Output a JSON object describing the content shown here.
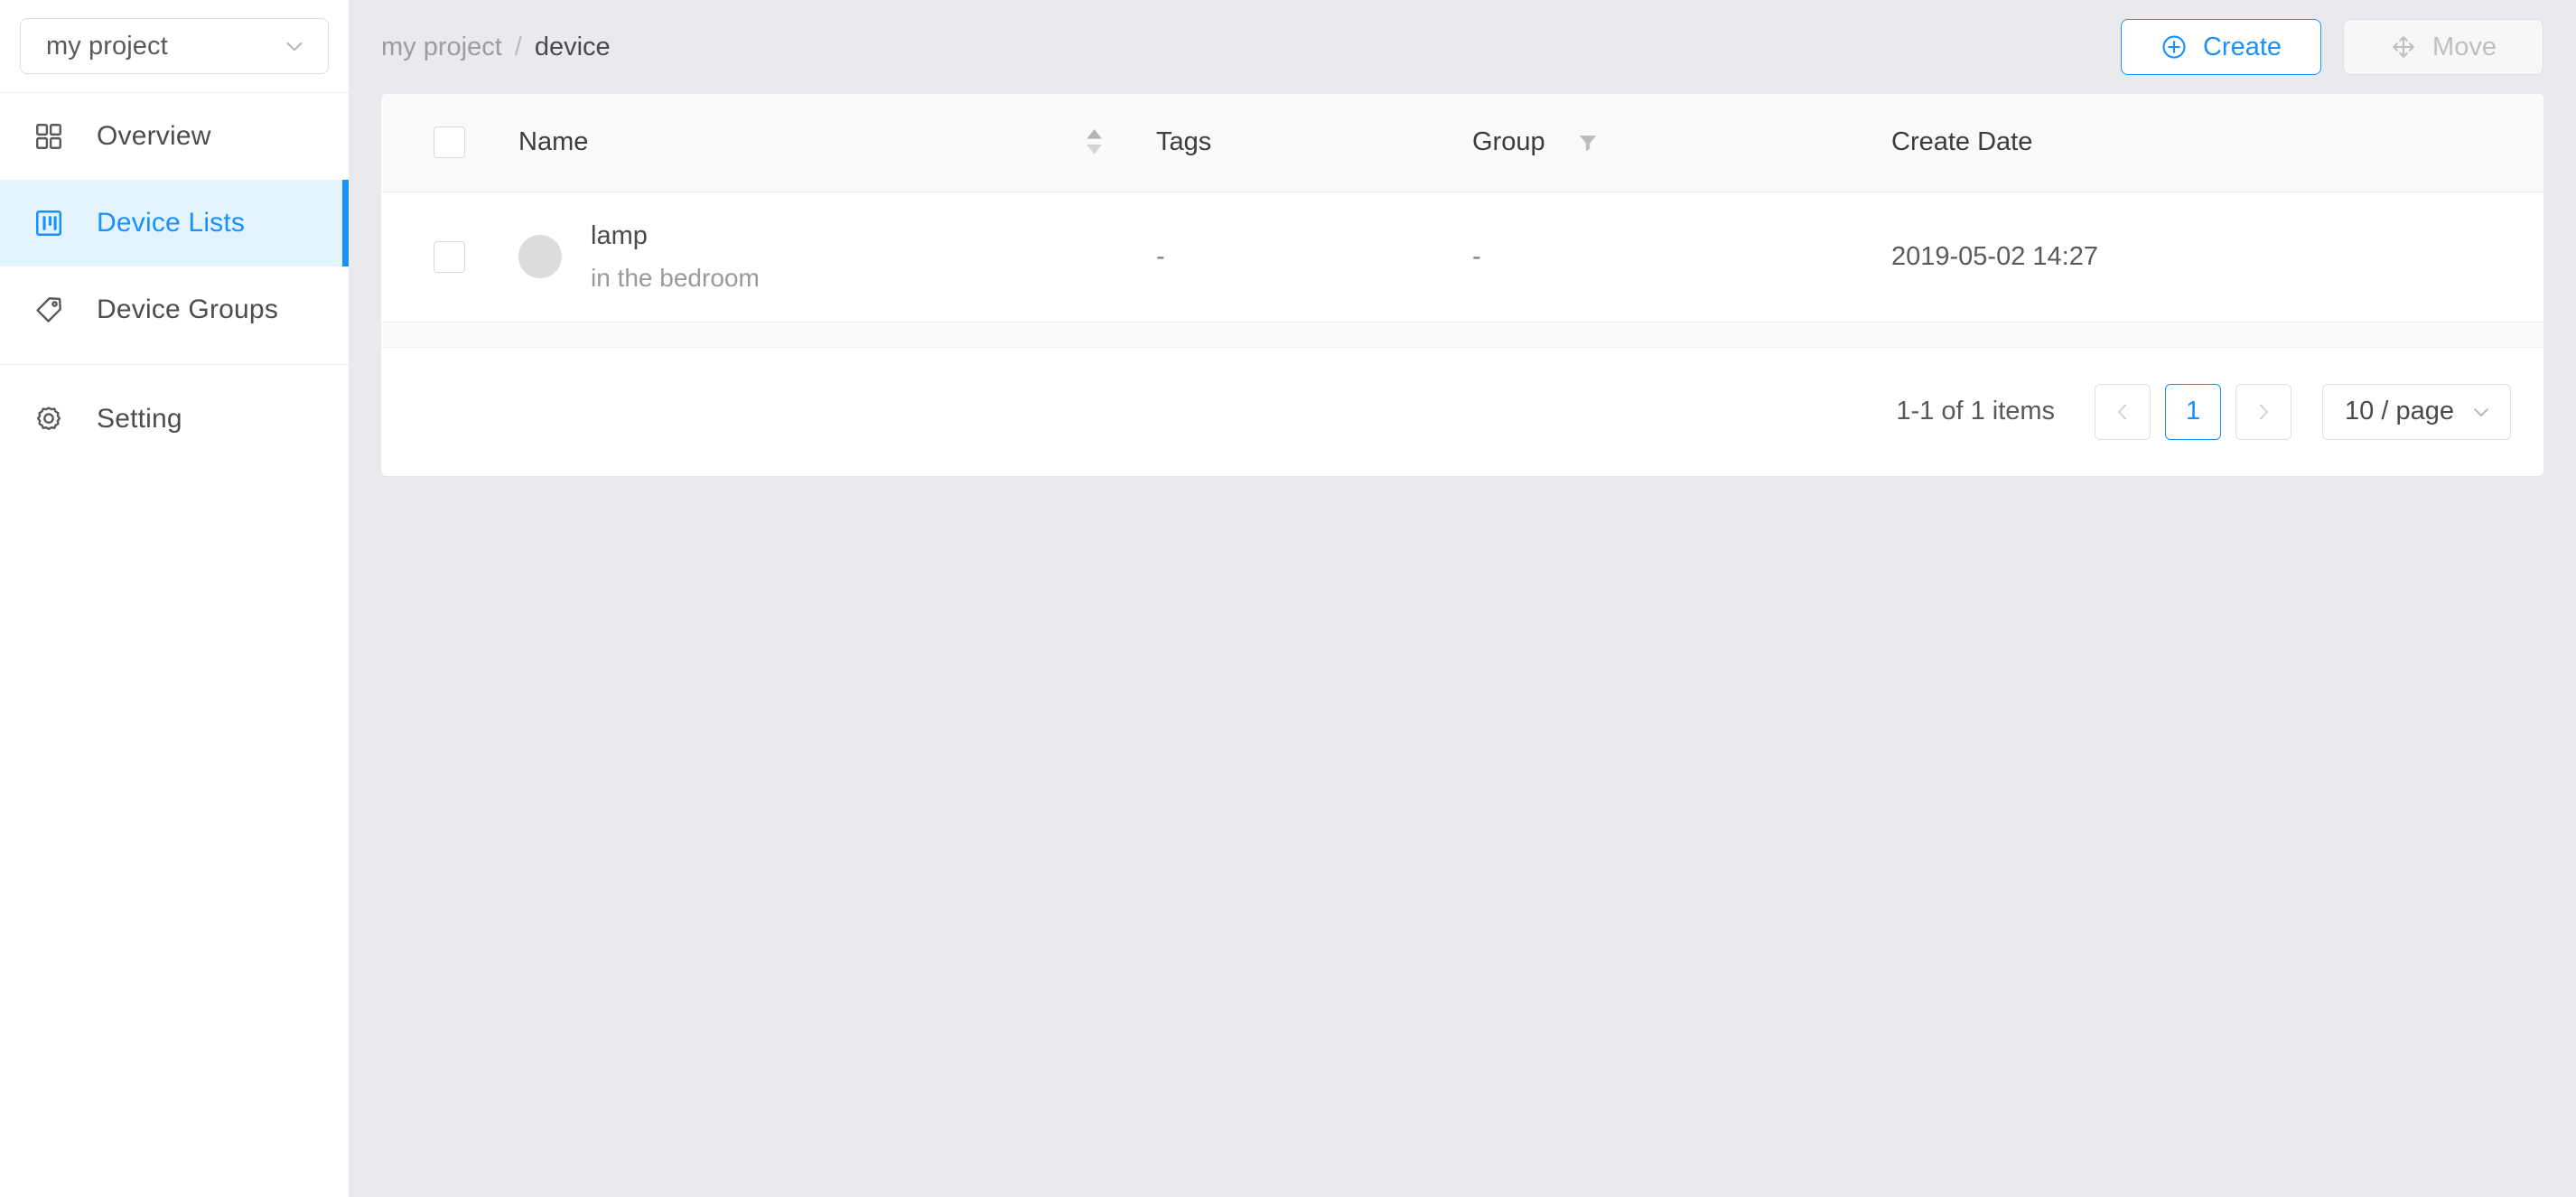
{
  "colors": {
    "accent": "#1890ff",
    "active_nav_bg": "#e3f4fe",
    "page_bg": "#e9eaee",
    "card_bg": "#ffffff",
    "table_header_bg": "#fafafa",
    "muted_text": "#9a9a9a",
    "disabled_text": "#bfbfbf"
  },
  "sidebar": {
    "project_selector": {
      "value": "my project",
      "icon": "chevron-down-icon"
    },
    "items": [
      {
        "label": "Overview",
        "icon": "grid-icon",
        "active": false
      },
      {
        "label": "Device Lists",
        "icon": "board-icon",
        "active": true
      },
      {
        "label": "Device Groups",
        "icon": "tag-icon",
        "active": false
      },
      {
        "label": "Setting",
        "icon": "gear-icon",
        "active": false
      }
    ]
  },
  "topbar": {
    "breadcrumb": {
      "parent": "my project",
      "separator": "/",
      "current": "device"
    },
    "create_button": {
      "label": "Create",
      "icon": "plus-circle-icon",
      "disabled": false
    },
    "move_button": {
      "label": "Move",
      "icon": "move-arrows-icon",
      "disabled": true
    }
  },
  "table": {
    "columns": [
      {
        "key": "check",
        "label": "",
        "sortable": false,
        "filterable": false
      },
      {
        "key": "name",
        "label": "Name",
        "sortable": true,
        "filterable": false
      },
      {
        "key": "tags",
        "label": "Tags",
        "sortable": false,
        "filterable": false
      },
      {
        "key": "group",
        "label": "Group",
        "sortable": false,
        "filterable": true
      },
      {
        "key": "date",
        "label": "Create Date",
        "sortable": false,
        "filterable": false
      }
    ],
    "rows": [
      {
        "selected": false,
        "name": "lamp",
        "description": "in the bedroom",
        "tags": "-",
        "group": "-",
        "create_date": "2019-05-02 14:27"
      }
    ]
  },
  "pagination": {
    "summary": "1-1 of 1 items",
    "prev_label": "‹",
    "next_label": "›",
    "pages": [
      {
        "label": "1",
        "active": true
      }
    ],
    "page_size": {
      "label": "10 / page",
      "icon": "chevron-down-icon"
    }
  }
}
